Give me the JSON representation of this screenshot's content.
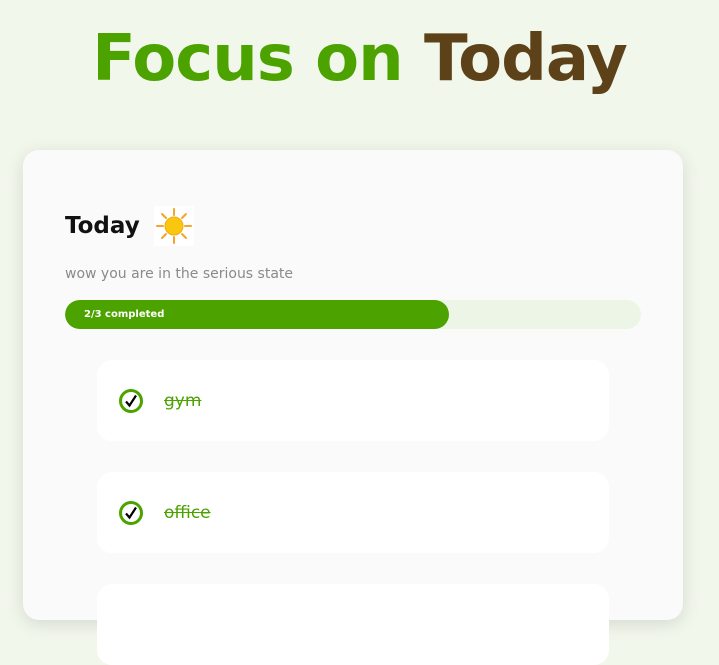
{
  "hero": {
    "word1": "Focus on",
    "word2": "Today"
  },
  "header": {
    "title": "Today",
    "icon": "sun-icon"
  },
  "subtitle": "wow you are in the serious state",
  "progress": {
    "label": "2/3 completed",
    "completed": 2,
    "total": 3
  },
  "tasks": [
    {
      "label": "gym",
      "done": true
    },
    {
      "label": "office",
      "done": true
    },
    {
      "label": "",
      "done": false
    }
  ],
  "colors": {
    "accent": "#4ca300",
    "brown": "#5d4219",
    "background": "#f2f7ec"
  }
}
